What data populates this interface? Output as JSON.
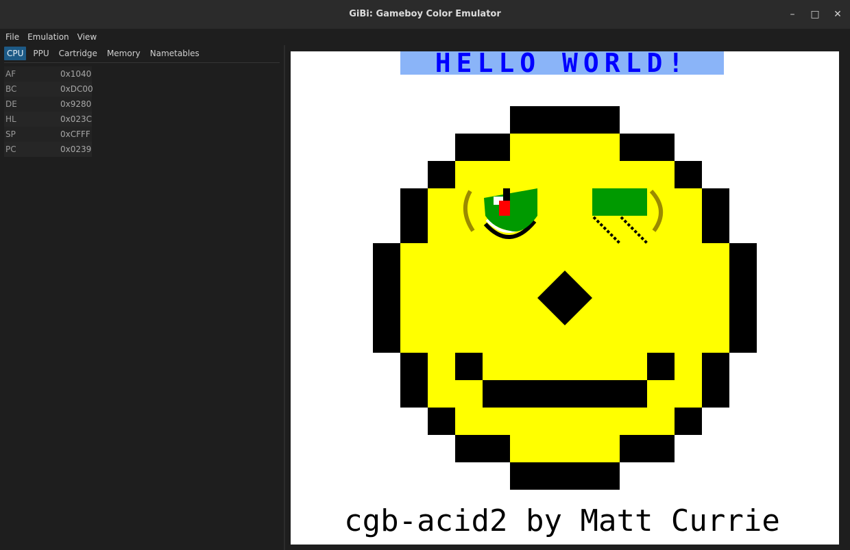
{
  "window": {
    "title": "GiBi: Gameboy Color Emulator",
    "controls": {
      "minimize": "–",
      "maximize": "□",
      "close": "✕"
    }
  },
  "menu": {
    "items": [
      {
        "label": "File"
      },
      {
        "label": "Emulation"
      },
      {
        "label": "View"
      }
    ]
  },
  "debugger": {
    "tabs": [
      {
        "label": "CPU",
        "active": true
      },
      {
        "label": "PPU",
        "active": false
      },
      {
        "label": "Cartridge",
        "active": false
      },
      {
        "label": "Memory",
        "active": false
      },
      {
        "label": "Nametables",
        "active": false
      }
    ],
    "registers": [
      {
        "name": "AF",
        "value": "0x1040"
      },
      {
        "name": "BC",
        "value": "0xDC00"
      },
      {
        "name": "DE",
        "value": "0x9280"
      },
      {
        "name": "HL",
        "value": "0x023C"
      },
      {
        "name": "SP",
        "value": "0xCFFF"
      },
      {
        "name": "PC",
        "value": "0x0239"
      }
    ]
  },
  "screen": {
    "header_text": "HELLO WORLD!",
    "footer_text": "cgb-acid2 by Matt Currie",
    "colors": {
      "background": "#ffffff",
      "face": "#ffff00",
      "outline": "#000000",
      "eye_green": "#009a00",
      "eye_red": "#ff0000",
      "brow_olive": "#9a8a00",
      "header_fg": "#0000ff",
      "header_bg": "#8ab4f8"
    }
  },
  "accent": "#1d5a86"
}
